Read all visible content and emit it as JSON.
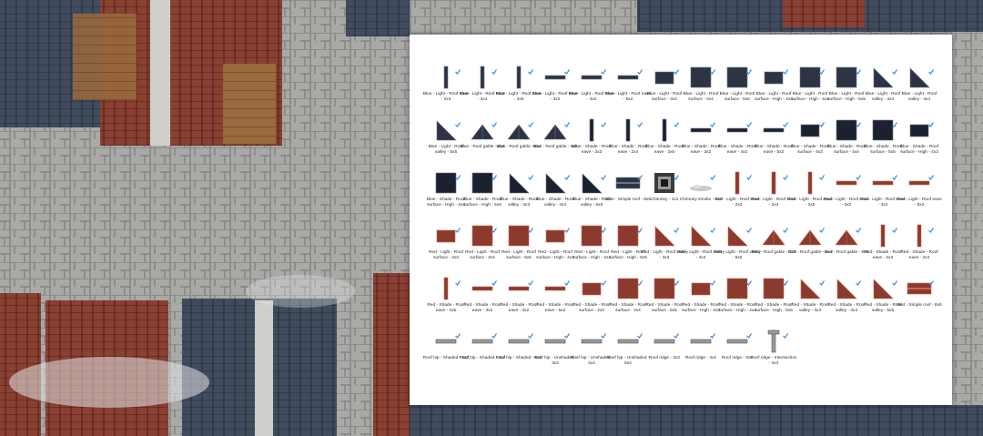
{
  "colors": {
    "blue_fill": "#2c3443",
    "blue_stroke": "#6a7488",
    "red_fill": "#8b3a2e",
    "red_stroke": "#c86a52",
    "shaded_fill": "#1c2130",
    "check": "#3b8fd6",
    "stone": "#9a9a9a"
  },
  "assets": [
    {
      "label": "Blue - Light - Roof eave - 2x3",
      "shape": "vbar",
      "color": "blue"
    },
    {
      "label": "Blue - Light - Roof eave - 2x4",
      "shape": "vbar",
      "color": "blue"
    },
    {
      "label": "Blue - Light - Roof eave - 2x5",
      "shape": "vbar",
      "color": "blue"
    },
    {
      "label": "Blue - Light - Roof eave - 3x2",
      "shape": "hbar",
      "color": "blue"
    },
    {
      "label": "Blue - Light - Roof eave - 4x2",
      "shape": "hbar",
      "color": "blue"
    },
    {
      "label": "Blue - Light - Roof eave - 5x2",
      "shape": "hbar",
      "color": "blue"
    },
    {
      "label": "Blue - Light - Roof surface - 3x3",
      "shape": "hrect",
      "color": "blue"
    },
    {
      "label": "Blue - Light - Roof surface - 4x4",
      "shape": "square",
      "color": "blue"
    },
    {
      "label": "Blue - Light - Roof surface - 5x5",
      "shape": "square",
      "color": "blue"
    },
    {
      "label": "Blue - Light - Roof surface - High - 4x3",
      "shape": "hrect",
      "color": "blue"
    },
    {
      "label": "Blue - Light - Roof surface - High - 4x4",
      "shape": "square",
      "color": "blue"
    },
    {
      "label": "Blue - Light - Roof surface - High - 5x5",
      "shape": "square",
      "color": "blue"
    },
    {
      "label": "Blue - Light - Roof valley - 3x3",
      "shape": "tri",
      "color": "blue"
    },
    {
      "label": "Blue - Light - Roof valley - 4x4",
      "shape": "tri",
      "color": "blue"
    },
    {
      "label": "Blue - Light - Roof valley - 5x5",
      "shape": "tri",
      "color": "blue"
    },
    {
      "label": "Blue - Roof gable - 4x3",
      "shape": "gable",
      "color": "blue"
    },
    {
      "label": "Blue - Roof gable - 6x4",
      "shape": "gable",
      "color": "blue"
    },
    {
      "label": "Blue - Roof gable - 8x5",
      "shape": "gable",
      "color": "blue"
    },
    {
      "label": "Blue - Shade - Roof eave - 2x3",
      "shape": "vbar",
      "color": "shaded"
    },
    {
      "label": "Blue - Shade - Roof eave - 2x4",
      "shape": "vbar",
      "color": "shaded"
    },
    {
      "label": "Blue - Shade - Roof eave - 2x5",
      "shape": "vbar",
      "color": "shaded"
    },
    {
      "label": "Blue - Shade - Roof eave - 3x2",
      "shape": "hbar",
      "color": "shaded"
    },
    {
      "label": "Blue - Shade - Roof eave - 4x2",
      "shape": "hbar",
      "color": "shaded"
    },
    {
      "label": "Blue - Shade - Roof eave - 5x2",
      "shape": "hbar",
      "color": "shaded"
    },
    {
      "label": "Blue - Shade - Roof surface - 4x3",
      "shape": "hrect",
      "color": "shaded"
    },
    {
      "label": "Blue - Shade - Roof surface - 4x4",
      "shape": "square",
      "color": "shaded"
    },
    {
      "label": "Blue - Shade - Roof surface - 5x5",
      "shape": "square",
      "color": "shaded"
    },
    {
      "label": "Blue - Shade - Roof surface - High - 4x3",
      "shape": "hrect",
      "color": "shaded"
    },
    {
      "label": "Blue - Shade - Roof surface - High - 4x4",
      "shape": "square",
      "color": "shaded"
    },
    {
      "label": "Blue - Shade - Roof surface - High - 5x5",
      "shape": "square",
      "color": "shaded"
    },
    {
      "label": "Blue - Shade - Roof valley - 3x3",
      "shape": "tri",
      "color": "shaded"
    },
    {
      "label": "Blue - Shade - Roof valley - 4x4",
      "shape": "tri",
      "color": "shaded"
    },
    {
      "label": "Blue - Shade - Roof valley - 5x5",
      "shape": "tri",
      "color": "shaded"
    },
    {
      "label": "Blue - Simple roof - 8x6",
      "shape": "wide",
      "color": "blue"
    },
    {
      "label": "Chimney - 1x1",
      "shape": "chimney",
      "color": "stone"
    },
    {
      "label": "Chimney smoke - 8x3",
      "shape": "smoke",
      "color": "stone"
    },
    {
      "label": "Red - Light - Roof eave - 2x3",
      "shape": "vbar",
      "color": "red"
    },
    {
      "label": "Red - Light - Roof eave - 2x4",
      "shape": "vbar",
      "color": "red"
    },
    {
      "label": "Red - Light - Roof eave - 2x5",
      "shape": "vbar",
      "color": "red"
    },
    {
      "label": "Red - Light - Roof eave - 3x2",
      "shape": "hbar",
      "color": "red"
    },
    {
      "label": "Red - Light - Roof eave - 4x2",
      "shape": "hbar",
      "color": "red"
    },
    {
      "label": "Red - Light - Roof eave - 5x2",
      "shape": "hbar",
      "color": "red"
    },
    {
      "label": "Red - Light - Roof surface - 4x3",
      "shape": "hrect",
      "color": "red"
    },
    {
      "label": "Red - Light - Roof surface - 4x4",
      "shape": "square",
      "color": "red"
    },
    {
      "label": "Red - Light - Roof surface - 5x5",
      "shape": "square",
      "color": "red"
    },
    {
      "label": "Red - Light - Roof surface - High - 4x3",
      "shape": "hrect",
      "color": "red"
    },
    {
      "label": "Red - Light - Roof surface - High - 4x4",
      "shape": "square",
      "color": "red"
    },
    {
      "label": "Red - Light - Roof surface - High - 5x5",
      "shape": "square",
      "color": "red"
    },
    {
      "label": "Red - Light - Roof valley - 3x3",
      "shape": "tri",
      "color": "red"
    },
    {
      "label": "Red - Light - Roof valley - 4x4",
      "shape": "tri",
      "color": "red"
    },
    {
      "label": "Red - Light - Roof valley - 5x5",
      "shape": "tri",
      "color": "red"
    },
    {
      "label": "Red - Roof gable - 4x3",
      "shape": "gable",
      "color": "red"
    },
    {
      "label": "Red - Roof gable - 6x4",
      "shape": "gable",
      "color": "red"
    },
    {
      "label": "Red - Roof gable - 8x5",
      "shape": "gable",
      "color": "red"
    },
    {
      "label": "Red - Shade - Roof eave - 2x3",
      "shape": "vbar",
      "color": "red"
    },
    {
      "label": "Red - Shade - Roof eave - 2x4",
      "shape": "vbar",
      "color": "red"
    },
    {
      "label": "Red - Shade - Roof eave - 2x5",
      "shape": "vbar",
      "color": "red"
    },
    {
      "label": "Red - Shade - Roof eave - 3x2",
      "shape": "hbar",
      "color": "red"
    },
    {
      "label": "Red - Shade - Roof eave - 4x2",
      "shape": "hbar",
      "color": "red"
    },
    {
      "label": "Red - Shade - Roof eave - 5x2",
      "shape": "hbar",
      "color": "red"
    },
    {
      "label": "Red - Shade - Roof surface - 4x3",
      "shape": "hrect",
      "color": "red"
    },
    {
      "label": "Red - Shade - Roof surface - 4x4",
      "shape": "square",
      "color": "red"
    },
    {
      "label": "Red - Shade - Roof surface - 5x5",
      "shape": "square",
      "color": "red"
    },
    {
      "label": "Red - Shade - Roof surface - High - 4x3",
      "shape": "hrect",
      "color": "red"
    },
    {
      "label": "Red - Shade - Roof surface - High - 4x4",
      "shape": "square",
      "color": "red"
    },
    {
      "label": "Red - Shade - Roof surface - High - 5x5",
      "shape": "square",
      "color": "red"
    },
    {
      "label": "Red - Shade - Roof valley - 3x3",
      "shape": "tri",
      "color": "red"
    },
    {
      "label": "Red - Shade - Roof valley - 4x4",
      "shape": "tri",
      "color": "red"
    },
    {
      "label": "Red - Shade - Roof valley - 5x5",
      "shape": "tri",
      "color": "red"
    },
    {
      "label": "Red - Simple roof - 8x6",
      "shape": "wide",
      "color": "red"
    },
    {
      "label": "Roof hip - Shaded - 3x2",
      "shape": "hbar",
      "color": "stone"
    },
    {
      "label": "Roof hip - Shaded - 4x2",
      "shape": "hbar",
      "color": "stone"
    },
    {
      "label": "Roof hip - Shaded - 5x2",
      "shape": "hbar",
      "color": "stone"
    },
    {
      "label": "Roof hip - Unshaded - 3x2",
      "shape": "hbar",
      "color": "stone"
    },
    {
      "label": "Roof hip - Unshaded - 4x2",
      "shape": "hbar",
      "color": "stone"
    },
    {
      "label": "Roof hip - Unshaded - 5x2",
      "shape": "hbar",
      "color": "stone"
    },
    {
      "label": "Roof ridge - 3x2",
      "shape": "hbar",
      "color": "stone"
    },
    {
      "label": "Roof ridge - 4x2",
      "shape": "hbar",
      "color": "stone"
    },
    {
      "label": "Roof ridge - 5x2",
      "shape": "hbar",
      "color": "stone"
    },
    {
      "label": "Roof ridge - Intersection - 2x3",
      "shape": "cross",
      "color": "stone"
    }
  ]
}
